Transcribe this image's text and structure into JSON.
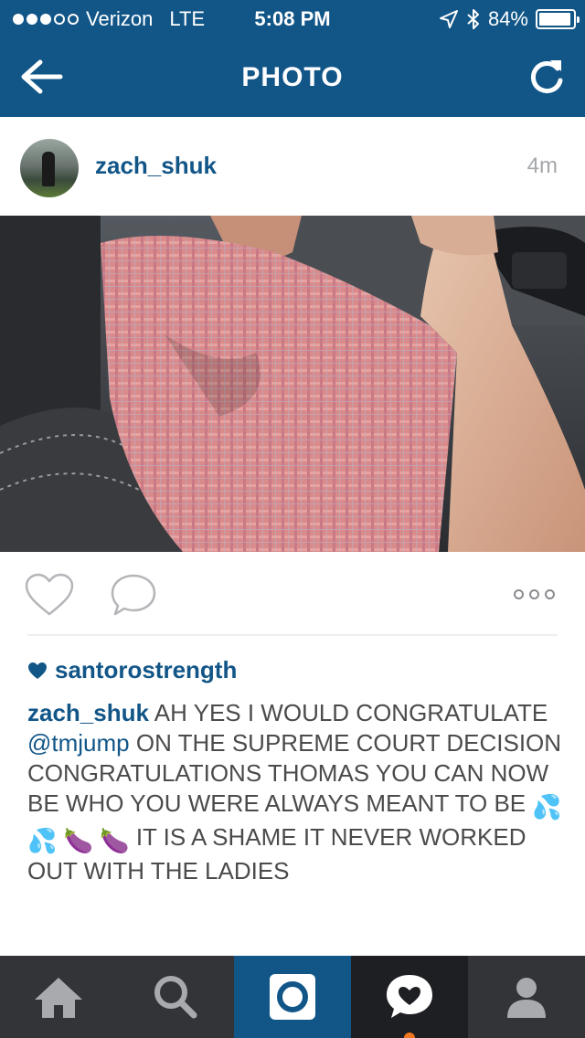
{
  "status_bar": {
    "carrier": "Verizon",
    "network": "LTE",
    "time": "5:08 PM",
    "battery": "84%",
    "battery_level": 0.84,
    "signal_bars_filled": 3,
    "signal_bars_total": 5
  },
  "nav": {
    "title": "PHOTO",
    "back_icon": "arrow-left-icon",
    "refresh_icon": "refresh-icon"
  },
  "post": {
    "username": "zach_shuk",
    "time_ago": "4m",
    "likes": {
      "liker": "santorostrength"
    },
    "caption": {
      "user": "zach_shuk",
      "text_1": " AH YES I WOULD CONGRATULATE ",
      "mention": "@tmjump",
      "text_2": " ON THE SUPREME COURT DECISION CONGRATULATIONS THOMAS YOU CAN NOW BE WHO YOU WERE ALWAYS MEANT TO BE ",
      "emojis": [
        "💦",
        "💦",
        "🍆",
        "🍆"
      ],
      "text_3": " IT IS A SHAME IT NEVER WORKED OUT WITH THE LADIES"
    }
  },
  "actions": {
    "like_icon": "heart-outline-icon",
    "comment_icon": "comment-bubble-icon",
    "more_icon": "more-dots-icon"
  },
  "tab_bar": {
    "tabs": [
      {
        "icon": "home-icon"
      },
      {
        "icon": "search-icon"
      },
      {
        "icon": "camera-icon",
        "active": true
      },
      {
        "icon": "activity-heart-icon",
        "has_notification": true
      },
      {
        "icon": "profile-icon"
      }
    ]
  },
  "colors": {
    "brand_blue": "#125688",
    "tab_bar": "#333438",
    "notification": "#f37621"
  }
}
